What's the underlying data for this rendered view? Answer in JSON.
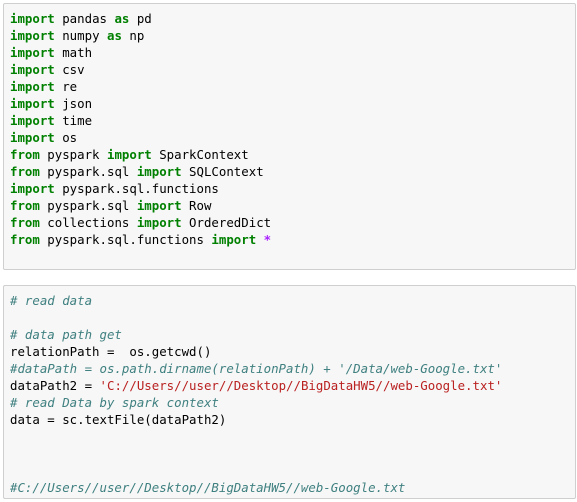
{
  "cells": [
    {
      "lines": [
        [
          {
            "t": "import",
            "c": "kw"
          },
          {
            "t": " pandas "
          },
          {
            "t": "as",
            "c": "kw"
          },
          {
            "t": " pd"
          }
        ],
        [
          {
            "t": "import",
            "c": "kw"
          },
          {
            "t": " numpy "
          },
          {
            "t": "as",
            "c": "kw"
          },
          {
            "t": " np"
          }
        ],
        [
          {
            "t": "import",
            "c": "kw"
          },
          {
            "t": " math"
          }
        ],
        [
          {
            "t": "import",
            "c": "kw"
          },
          {
            "t": " csv"
          }
        ],
        [
          {
            "t": "import",
            "c": "kw"
          },
          {
            "t": " re"
          }
        ],
        [
          {
            "t": "import",
            "c": "kw"
          },
          {
            "t": " json"
          }
        ],
        [
          {
            "t": "import",
            "c": "kw"
          },
          {
            "t": " time"
          }
        ],
        [
          {
            "t": "import",
            "c": "kw"
          },
          {
            "t": " os"
          }
        ],
        [
          {
            "t": "from",
            "c": "kw"
          },
          {
            "t": " pyspark "
          },
          {
            "t": "import",
            "c": "kw"
          },
          {
            "t": " SparkContext"
          }
        ],
        [
          {
            "t": "from",
            "c": "kw"
          },
          {
            "t": " pyspark.sql "
          },
          {
            "t": "import",
            "c": "kw"
          },
          {
            "t": " SQLContext"
          }
        ],
        [
          {
            "t": "import",
            "c": "kw"
          },
          {
            "t": " pyspark.sql.functions"
          }
        ],
        [
          {
            "t": "from",
            "c": "kw"
          },
          {
            "t": " pyspark.sql "
          },
          {
            "t": "import",
            "c": "kw"
          },
          {
            "t": " Row"
          }
        ],
        [
          {
            "t": "from",
            "c": "kw"
          },
          {
            "t": " collections "
          },
          {
            "t": "import",
            "c": "kw"
          },
          {
            "t": " OrderedDict"
          }
        ],
        [
          {
            "t": "from",
            "c": "kw"
          },
          {
            "t": " pyspark.sql.functions "
          },
          {
            "t": "import",
            "c": "kw"
          },
          {
            "t": " "
          },
          {
            "t": "*",
            "c": "op"
          }
        ]
      ]
    },
    {
      "lines": [
        [
          {
            "t": "# read data",
            "c": "cm"
          }
        ],
        [],
        [
          {
            "t": "# data path get",
            "c": "cm"
          }
        ],
        [
          {
            "t": "relationPath =  os.getcwd()"
          }
        ],
        [
          {
            "t": "#dataPath = os.path.dirname(relationPath) + '/Data/web-Google.txt'",
            "c": "cm"
          }
        ],
        [
          {
            "t": "dataPath2 = "
          },
          {
            "t": "'C://Users//user//Desktop//BigDataHW5//web-Google.txt'",
            "c": "str"
          }
        ],
        [
          {
            "t": "# read Data by spark context",
            "c": "cm"
          }
        ],
        [
          {
            "t": "data = sc.textFile(dataPath2)"
          }
        ],
        [],
        [],
        [],
        [
          {
            "t": "#C://Users//user//Desktop//BigDataHW5//web-Google.txt",
            "c": "cm"
          }
        ]
      ]
    }
  ],
  "colors": {
    "keyword": "#008000",
    "operator": "#aa22ff",
    "string": "#ba2121",
    "comment": "#408080",
    "cell_background": "#f7f7f7",
    "cell_border": "#cfcfcf"
  }
}
